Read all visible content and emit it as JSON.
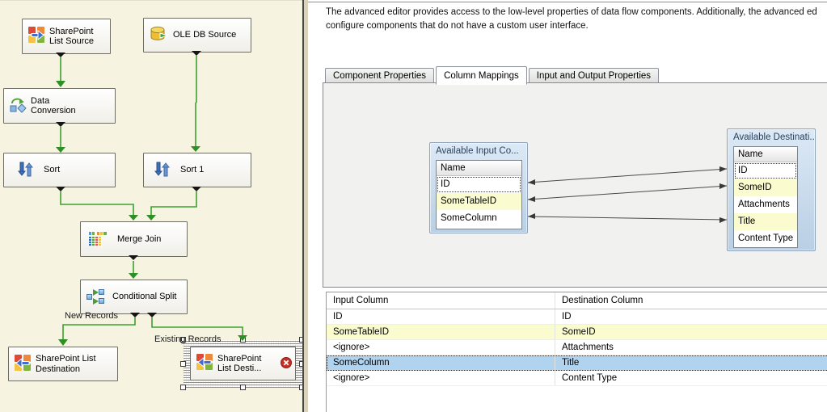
{
  "designer": {
    "nodes": [
      {
        "label": "SharePoint List Source",
        "icon": "sharepoint-source-icon"
      },
      {
        "label": "OLE DB Source",
        "icon": "database-source-icon"
      },
      {
        "label": "Data Conversion",
        "icon": "data-conversion-icon"
      },
      {
        "label": "Sort",
        "icon": "sort-icon"
      },
      {
        "label": "Sort 1",
        "icon": "sort-icon"
      },
      {
        "label": "Merge Join",
        "icon": "merge-join-icon"
      },
      {
        "label": "Conditional Split",
        "icon": "conditional-split-icon"
      },
      {
        "label": "SharePoint List Destination",
        "icon": "sharepoint-destination-icon"
      },
      {
        "label": "SharePoint List Desti...",
        "icon": "sharepoint-destination-icon",
        "selected": true,
        "error": true
      }
    ],
    "edge_labels": {
      "new_records": "New Records",
      "existing_records": "Existing Records"
    }
  },
  "dialog": {
    "description": {
      "line1": "The advanced editor provides access to the low-level properties of data flow components. Additionally, the advanced ed",
      "line2": "configure components that do not have a custom user interface."
    },
    "tabs": [
      {
        "label": "Component Properties",
        "active": false
      },
      {
        "label": "Column Mappings",
        "active": true
      },
      {
        "label": "Input and Output Properties",
        "active": false
      }
    ],
    "mapping": {
      "input_box": {
        "title": "Available Input Co...",
        "column_header": "Name",
        "rows": [
          {
            "name": "ID",
            "focused": true
          },
          {
            "name": "SomeTableID",
            "highlighted": true
          },
          {
            "name": "SomeColumn",
            "highlighted": false
          }
        ]
      },
      "destination_box": {
        "title": "Available Destinati...",
        "column_header": "Name",
        "rows": [
          {
            "name": "ID",
            "focused": true
          },
          {
            "name": "SomeID",
            "highlighted": true
          },
          {
            "name": "Attachments",
            "highlighted": false
          },
          {
            "name": "Title",
            "highlighted": true
          },
          {
            "name": "Content Type",
            "highlighted": false
          }
        ]
      }
    },
    "table": {
      "headers": [
        "Input Column",
        "Destination Column"
      ],
      "rows": [
        {
          "input": "ID",
          "destination": "ID"
        },
        {
          "input": "SomeTableID",
          "destination": "SomeID",
          "highlighted": true
        },
        {
          "input": "<ignore>",
          "destination": "Attachments"
        },
        {
          "input": "SomeColumn",
          "destination": "Title",
          "selected": true
        },
        {
          "input": "<ignore>",
          "destination": "Content Type"
        }
      ]
    }
  },
  "colors": {
    "designer_background": "#F7F3E1",
    "connector_green": "#3BA12E",
    "highlight_yellow": "#FBFBD0",
    "selected_row_blue": "#B0D3F0",
    "error_red": "#C62F24"
  }
}
